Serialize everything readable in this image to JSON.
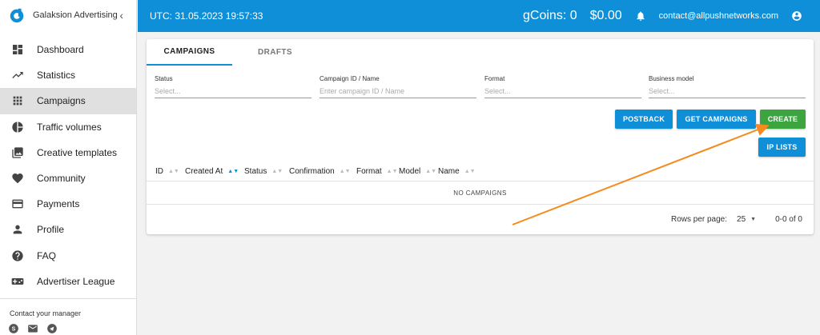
{
  "sidebar": {
    "brand": "Galaksion Advertising",
    "items": [
      {
        "label": "Dashboard"
      },
      {
        "label": "Statistics"
      },
      {
        "label": "Campaigns"
      },
      {
        "label": "Traffic volumes"
      },
      {
        "label": "Creative templates"
      },
      {
        "label": "Community"
      },
      {
        "label": "Payments"
      },
      {
        "label": "Profile"
      },
      {
        "label": "FAQ"
      },
      {
        "label": "Advertiser League"
      }
    ],
    "contact_title": "Contact your manager"
  },
  "topbar": {
    "utc": "UTC: 31.05.2023 19:57:33",
    "gcoins": "gCoins: 0",
    "balance": "$0.00",
    "email": "contact@allpushnetworks.com"
  },
  "tabs": [
    {
      "label": "CAMPAIGNS"
    },
    {
      "label": "DRAFTS"
    }
  ],
  "filters": [
    {
      "label": "Status",
      "placeholder": "Select..."
    },
    {
      "label": "Campaign ID / Name",
      "placeholder": "Enter campaign ID / Name"
    },
    {
      "label": "Format",
      "placeholder": "Select..."
    },
    {
      "label": "Business model",
      "placeholder": "Select..."
    }
  ],
  "buttons": {
    "postback": "POSTBACK",
    "get_campaigns": "GET CAMPAIGNS",
    "create": "CREATE",
    "ip_lists": "IP LISTS"
  },
  "table": {
    "columns": [
      "ID",
      "Created At",
      "Status",
      "Confirmation",
      "Format",
      "Model",
      "Name"
    ],
    "empty": "NO CAMPAIGNS"
  },
  "pagination": {
    "rows_per_page_label": "Rows per page:",
    "rows_per_page": "25",
    "range": "0-0 of 0"
  },
  "colors": {
    "primary": "#0e8fd8",
    "create": "#3da540",
    "annotation_arrow": "#f58b1f"
  }
}
